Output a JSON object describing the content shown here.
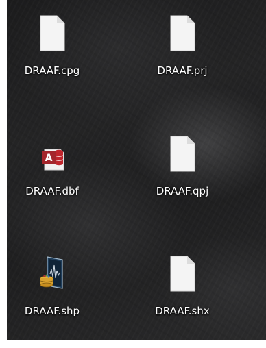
{
  "desktop": {
    "icons": [
      {
        "label": "DRAAF.cpg",
        "icon": "blank-file-icon"
      },
      {
        "label": "DRAAF.prj",
        "icon": "blank-file-icon"
      },
      {
        "label": "DRAAF.dbf",
        "icon": "access-database-icon"
      },
      {
        "label": "DRAAF.qpj",
        "icon": "blank-file-icon"
      },
      {
        "label": "DRAAF.shp",
        "icon": "shapefile-icon"
      },
      {
        "label": "DRAAF.shx",
        "icon": "blank-file-icon"
      }
    ],
    "colors": {
      "label_text": "#ffffff",
      "access_red": "#c0262d",
      "file_white": "#f4f4f4"
    }
  }
}
